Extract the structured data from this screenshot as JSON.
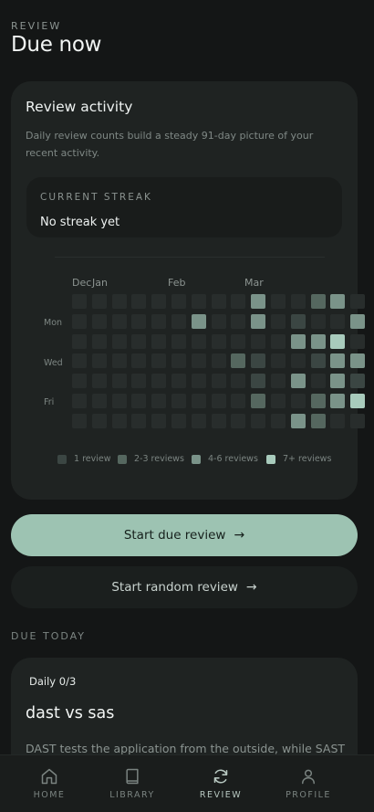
{
  "header": {
    "eyebrow": "REVIEW",
    "title": "Due now"
  },
  "activity": {
    "title": "Review activity",
    "description": "Daily review counts build a steady 91-day picture of your recent activity.",
    "streak_label": "CURRENT STREAK",
    "streak_value": "No streak yet",
    "months": [
      "Dec",
      "Jan",
      "Feb",
      "Mar"
    ],
    "day_labels": [
      "Mon",
      "Wed",
      "Fri"
    ],
    "legend": [
      "1 review",
      "2-3 reviews",
      "4-6 reviews",
      "7+ reviews"
    ],
    "levels_by_week": [
      [
        0,
        0,
        0,
        0,
        0,
        0,
        0
      ],
      [
        0,
        0,
        0,
        0,
        0,
        0,
        0
      ],
      [
        0,
        0,
        0,
        0,
        0,
        0,
        0
      ],
      [
        0,
        0,
        0,
        0,
        0,
        0,
        0
      ],
      [
        0,
        0,
        0,
        0,
        0,
        0,
        0
      ],
      [
        0,
        0,
        0,
        0,
        0,
        0,
        0
      ],
      [
        0,
        3,
        0,
        0,
        0,
        0,
        0
      ],
      [
        0,
        0,
        0,
        0,
        0,
        0,
        0
      ],
      [
        0,
        0,
        0,
        2,
        0,
        0,
        0
      ],
      [
        3,
        3,
        0,
        1,
        1,
        2,
        0
      ],
      [
        0,
        0,
        0,
        0,
        0,
        0,
        0
      ],
      [
        0,
        1,
        3,
        0,
        3,
        0,
        3
      ],
      [
        2,
        0,
        3,
        1,
        0,
        2,
        2
      ],
      [
        3,
        0,
        4,
        3,
        3,
        3,
        0
      ],
      [
        0,
        3,
        0,
        3,
        1,
        4,
        0
      ]
    ]
  },
  "actions": {
    "primary": "Start due review",
    "secondary": "Start random review"
  },
  "due_today": {
    "section_label": "DUE TODAY",
    "badge": "Daily 0/3",
    "title": "dast vs sas",
    "text": "DAST tests the application from the outside, while SAST"
  },
  "nav": [
    {
      "label": "HOME",
      "icon": "home-icon"
    },
    {
      "label": "LIBRARY",
      "icon": "book-icon"
    },
    {
      "label": "REVIEW",
      "icon": "refresh-icon",
      "active": true
    },
    {
      "label": "PROFILE",
      "icon": "user-icon"
    }
  ]
}
